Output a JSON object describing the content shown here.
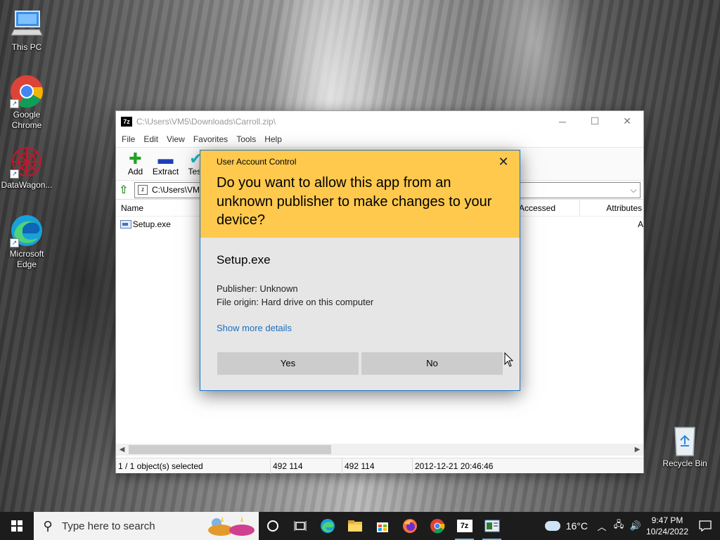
{
  "desktop": {
    "icons": [
      {
        "label_line1": "This PC",
        "label_line2": ""
      },
      {
        "label_line1": "Google",
        "label_line2": "Chrome"
      },
      {
        "label_line1": "DataWagon...",
        "label_line2": ""
      },
      {
        "label_line1": "Microsoft",
        "label_line2": "Edge"
      },
      {
        "label_line1": "Recycle Bin",
        "label_line2": ""
      }
    ]
  },
  "sevenzip": {
    "title": "C:\\Users\\VM5\\Downloads\\Carroll.zip\\",
    "menu": [
      "File",
      "Edit",
      "View",
      "Favorites",
      "Tools",
      "Help"
    ],
    "toolbar": {
      "add": "Add",
      "extract": "Extract",
      "test": "Test"
    },
    "address": "C:\\Users\\VM5\\Downloads\\Carroll.zip\\",
    "columns": {
      "name": "Name",
      "accessed": "Accessed",
      "attributes": "Attributes"
    },
    "files": [
      {
        "name": "Setup.exe",
        "attr": "A"
      }
    ],
    "status": {
      "selected": "1 / 1 object(s) selected",
      "size": "492 114",
      "packed": "492 114",
      "modified": "2012-12-21 20:46:46"
    }
  },
  "uac": {
    "header_label": "User Account Control",
    "question": "Do you want to allow this app from an unknown publisher to make changes to your device?",
    "app_name": "Setup.exe",
    "publisher": "Publisher: Unknown",
    "origin": "File origin: Hard drive on this computer",
    "more_details": "Show more details",
    "yes": "Yes",
    "no": "No",
    "colors": {
      "header": "#fec94d",
      "body": "#e6e6e6",
      "link": "#1a6fc0"
    }
  },
  "taskbar": {
    "search_placeholder": "Type here to search",
    "temperature": "16°C",
    "time": "9:47 PM",
    "date": "10/24/2022"
  }
}
